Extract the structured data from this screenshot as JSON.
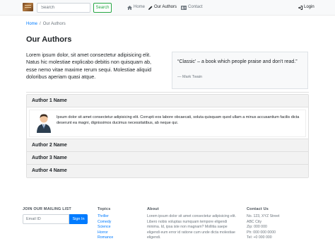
{
  "navbar": {
    "search_placeholder": "Search",
    "search_button": "Search",
    "links": [
      {
        "label": "Home",
        "icon": "home-icon"
      },
      {
        "label": "Our Authors",
        "icon": "pen-icon"
      },
      {
        "label": "Contact",
        "icon": "address-card-icon"
      }
    ],
    "login": {
      "label": "Login",
      "icon": "sign-in-icon"
    }
  },
  "breadcrumb": {
    "home": "Home",
    "separator": "/",
    "current": "Our Authors"
  },
  "page": {
    "title": "Our Authors",
    "lead": "Lorem ipsum dolor, sit amet consectetur adipisicing elit. Natus hic molestiae explicabo debitis non quisquam ab, esse nemo vitae maxime rerum sequi. Molestiae aliquid doloribus aperiam quasi atque."
  },
  "quote": {
    "text": "“Classic’ – a book which people praise and don't read.”",
    "author": "— Mark Twain"
  },
  "accordion": [
    {
      "title": "Author 1 Name",
      "expanded": true,
      "body": "Ipsum dolor sit amet consectetur adipisicing elit. Corrupti eos labore obcaecati, soluta quisquam quod ullam a minus accusantium facilis dicta deserunt ea magni, dignissimos ducimus necessitatibus, ab neque qui."
    },
    {
      "title": "Author 2 Name",
      "expanded": false
    },
    {
      "title": "Author 3 Name",
      "expanded": false
    },
    {
      "title": "Author 4 Name",
      "expanded": false
    }
  ],
  "footer": {
    "mailing": {
      "title": "JOIN OUR MAILING LIST",
      "placeholder": "Email ID",
      "button": "Sign In"
    },
    "topics": {
      "title": "Topics",
      "items": [
        "Thriller",
        "Comedy",
        "Science",
        "Horror",
        "Romance"
      ]
    },
    "about": {
      "title": "About",
      "text": "Lorem ipsum dolor sit amet consectetur adipisicing elit. Libero nobis voluptas numquam tempore eligendi minima. Id, ipsa iste non magnam? Mollitia saepe eligendi eum error id ratione cum unde dicta molestiae eligendi."
    },
    "contact": {
      "title": "Contact Us",
      "lines": [
        "No. 123, XYZ Street",
        "ABC City",
        "Zip: 000 000",
        "Ph: 000 000 0000",
        "Tel: +0 000 000"
      ]
    }
  },
  "colors": {
    "primary": "#007bff",
    "success": "#28a745",
    "navbar_bg": "#f8f9fa",
    "muted": "#6c757d"
  }
}
